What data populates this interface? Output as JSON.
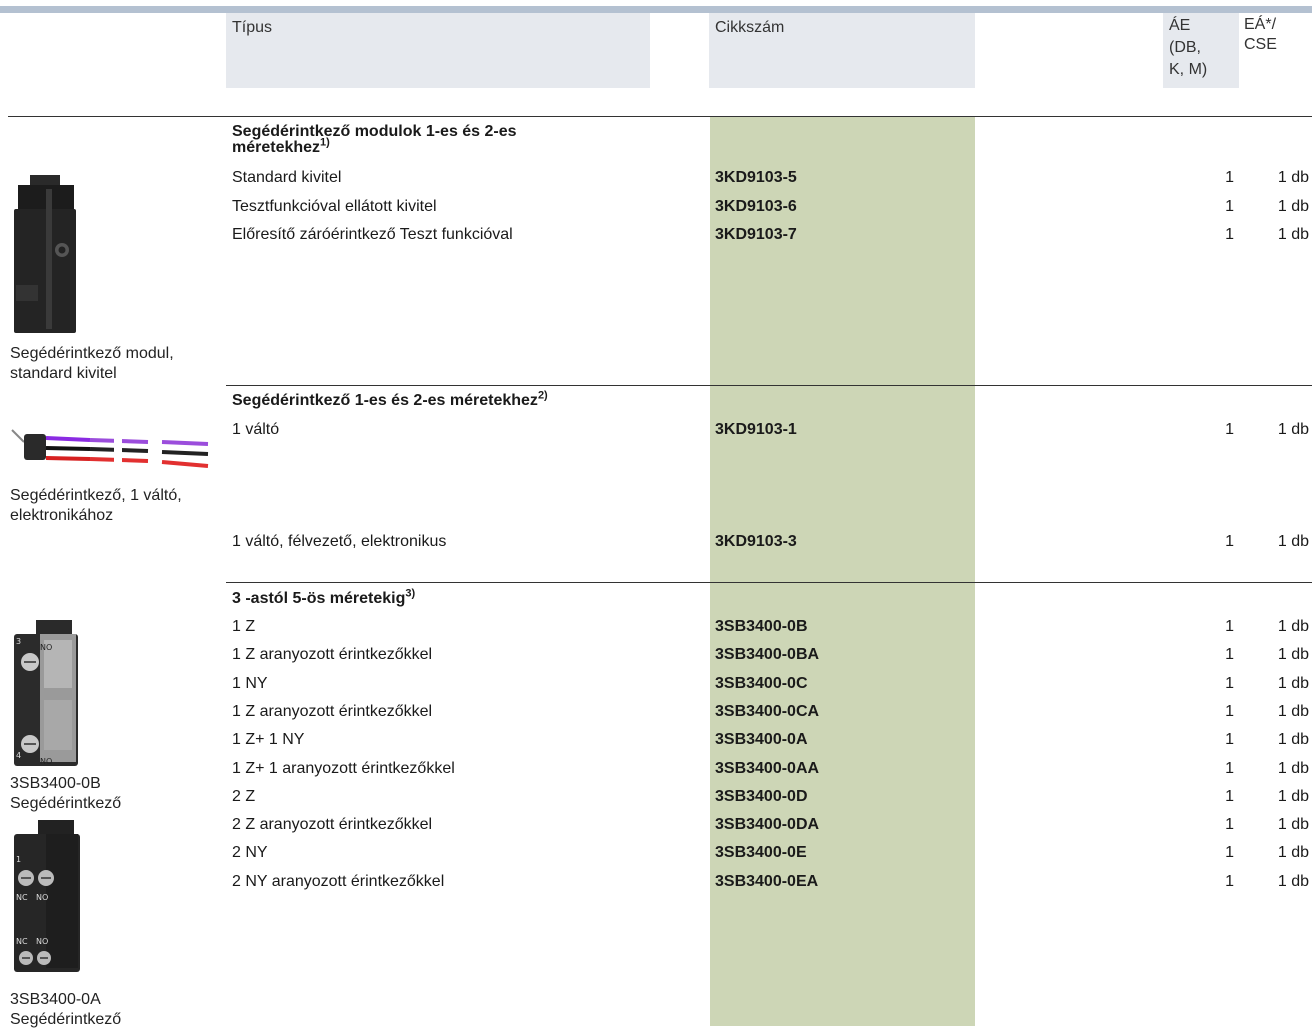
{
  "header": {
    "col_type": "Típus",
    "col_order": "Cikkszám",
    "col_pu_lines": [
      "ÁE",
      "(DB,",
      "K, M)"
    ],
    "col_ps_lines": [
      "EÁ*/",
      "CSE"
    ]
  },
  "images": [
    {
      "icon": "auxiliary-contact-module-image",
      "caption_lines": [
        "Segédérintkező modul,",
        "standard kivitel"
      ]
    },
    {
      "icon": "auxiliary-switch-wires-image",
      "caption_lines": [
        "Segédérintkező, 1 váltó,",
        "elektronikához"
      ]
    },
    {
      "icon": "contact-block-3sb3400-0b-image",
      "caption_lines": [
        "3SB3400-0B",
        "Segédérintkező"
      ]
    },
    {
      "icon": "contact-block-3sb3400-0a-image",
      "caption_lines": [
        "3SB3400-0A",
        "Segédérintkező"
      ]
    }
  ],
  "sections": [
    {
      "title_lines": [
        "Segédérintkező modulok 1-es és 2-es",
        "méretekhez"
      ],
      "footnote": "1)",
      "rows": [
        {
          "type": "Standard kivitel",
          "order_no": "3KD9103-5",
          "pu": "1",
          "ps": "1 db"
        },
        {
          "type": "Tesztfunkcióval ellátott kivitel",
          "order_no": "3KD9103-6",
          "pu": "1",
          "ps": "1 db"
        },
        {
          "type": "Előresítő záróérintkező Teszt funkcióval",
          "order_no": "3KD9103-7",
          "pu": "1",
          "ps": "1 db"
        }
      ]
    },
    {
      "title_lines": [
        "Segédérintkező 1-es és 2-es méretekhez"
      ],
      "footnote": "2)",
      "rows": [
        {
          "type": "1 váltó",
          "order_no": "3KD9103-1",
          "pu": "1",
          "ps": "1 db"
        },
        {
          "type": "1 váltó, félvezető, elektronikus",
          "order_no": "3KD9103-3",
          "pu": "1",
          "ps": "1 db"
        }
      ]
    },
    {
      "title_lines": [
        "3 -astól 5-ös méretekig"
      ],
      "footnote": "3)",
      "rows": [
        {
          "type": "1 Z",
          "order_no": "3SB3400-0B",
          "pu": "1",
          "ps": "1 db"
        },
        {
          "type": "1 Z aranyozott érintkezőkkel",
          "order_no": "3SB3400-0BA",
          "pu": "1",
          "ps": "1 db"
        },
        {
          "type": "1 NY",
          "order_no": "3SB3400-0C",
          "pu": "1",
          "ps": "1 db"
        },
        {
          "type": "1 Z aranyozott érintkezőkkel",
          "order_no": "3SB3400-0CA",
          "pu": "1",
          "ps": "1 db"
        },
        {
          "type": "1 Z+ 1 NY",
          "order_no": "3SB3400-0A",
          "pu": "1",
          "ps": "1 db"
        },
        {
          "type": "1 Z+ 1 aranyozott érintkezőkkel",
          "order_no": "3SB3400-0AA",
          "pu": "1",
          "ps": "1 db"
        },
        {
          "type": "2 Z",
          "order_no": "3SB3400-0D",
          "pu": "1",
          "ps": "1 db"
        },
        {
          "type": "2 Z aranyozott érintkezőkkel",
          "order_no": "3SB3400-0DA",
          "pu": "1",
          "ps": "1 db"
        },
        {
          "type": "2 NY",
          "order_no": "3SB3400-0E",
          "pu": "1",
          "ps": "1 db"
        },
        {
          "type": "2 NY aranyozott érintkezőkkel",
          "order_no": "3SB3400-0EA",
          "pu": "1",
          "ps": "1 db"
        }
      ]
    }
  ]
}
